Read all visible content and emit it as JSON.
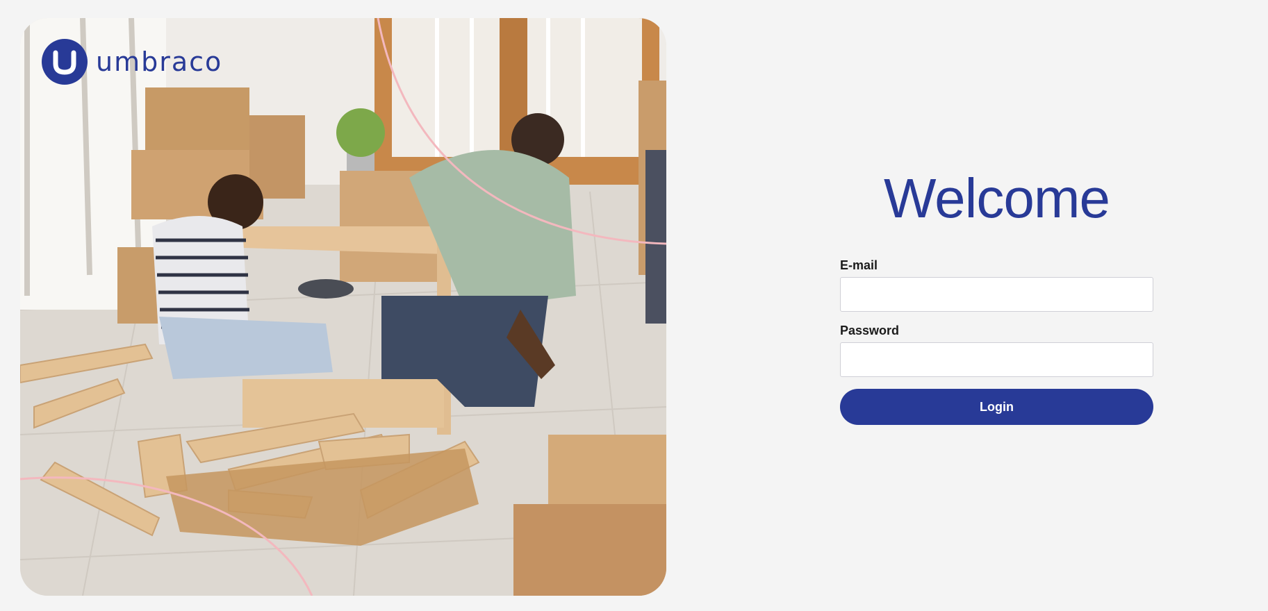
{
  "brand": {
    "name": "umbraco",
    "logo_icon": "umbraco-u-icon",
    "color": "#283a97"
  },
  "hero_image": {
    "icon": "photo-couple-assembling-furniture"
  },
  "login": {
    "title": "Welcome",
    "email_label": "E-mail",
    "email_value": "",
    "password_label": "Password",
    "password_value": "",
    "submit_label": "Login"
  },
  "colors": {
    "background": "#f4f4f4",
    "accent": "#283a97",
    "curve": "#f3b8be"
  }
}
